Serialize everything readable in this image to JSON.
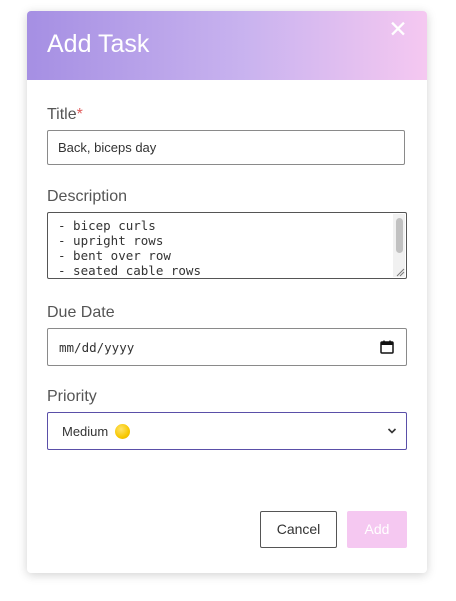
{
  "dialog": {
    "title": "Add Task",
    "close_icon": "close-icon"
  },
  "form": {
    "title_field": {
      "label": "Title",
      "required_mark": "*",
      "value": "Back, biceps day"
    },
    "description_field": {
      "label": "Description",
      "lines": [
        "- bicep curls",
        "- upright rows",
        "- bent over row",
        "- seated cable rows"
      ]
    },
    "due_date_field": {
      "label": "Due Date",
      "placeholder": "mm/dd/yyyy",
      "icon": "calendar-icon"
    },
    "priority_field": {
      "label": "Priority",
      "selected_value": "Medium",
      "selected_icon": "yellow-circle-emoji"
    }
  },
  "actions": {
    "cancel_label": "Cancel",
    "add_label": "Add"
  },
  "colors": {
    "header_gradient_start": "#a58fe3",
    "header_gradient_end": "#f5c8f1",
    "add_button": "#f5c8f1",
    "required_mark": "#e05a5a",
    "select_border": "#5a4fa8"
  }
}
